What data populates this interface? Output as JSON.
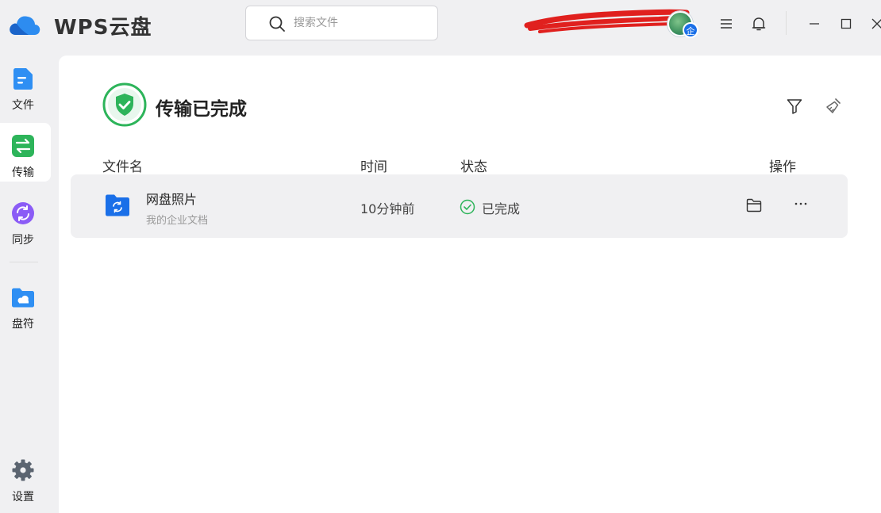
{
  "app": {
    "name": "WPS云盘"
  },
  "search": {
    "placeholder": "搜索文件"
  },
  "user": {
    "name": "",
    "enterprise_badge": "企"
  },
  "sidebar": {
    "items": [
      {
        "label": "文件",
        "icon": "file-icon"
      },
      {
        "label": "传输",
        "icon": "transfer-icon",
        "active": true
      },
      {
        "label": "同步",
        "icon": "sync-icon"
      },
      {
        "label": "盘符",
        "icon": "drive-icon"
      }
    ],
    "settings_label": "设置"
  },
  "main": {
    "title": "传输已完成",
    "columns": {
      "name": "文件名",
      "time": "时间",
      "status": "状态",
      "actions": "操作"
    },
    "rows": [
      {
        "name": "网盘照片",
        "location": "我的企业文档",
        "time": "10分钟前",
        "status": "已完成"
      }
    ]
  },
  "colors": {
    "accent_blue": "#1a6fe8",
    "success_green": "#2db45a",
    "sidebar_bg": "#f0f0f2"
  }
}
